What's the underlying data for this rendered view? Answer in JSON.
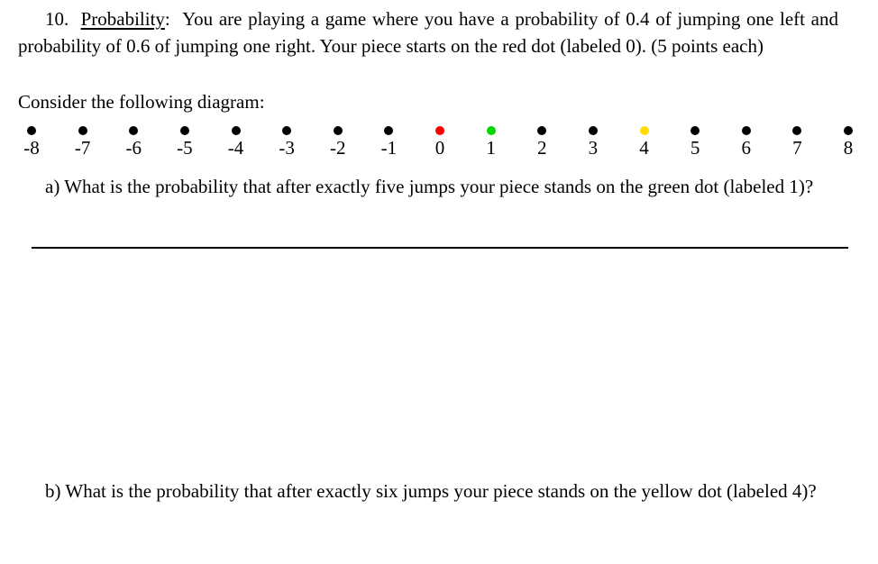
{
  "document": {
    "problem_number": "10.",
    "topic_label": "Probability",
    "topic_colon": ":",
    "statement_line1": "You are playing a game where you have a probability of 0.4 of",
    "statement_line2": "jumping one left and probability of 0.6 of jumping one right. Your piece starts on the red",
    "statement_line3": "dot (labeled 0). (5 points each)",
    "consider_line": "Consider the following diagram:"
  },
  "diagram": {
    "type": "number-line",
    "min": -8,
    "max": 8,
    "axis_color": "#000000",
    "default_dot_color": "#000000",
    "nodes": [
      {
        "value": -8,
        "label": "-8",
        "color": "#000000",
        "name": "minus-8"
      },
      {
        "value": -7,
        "label": "-7",
        "color": "#000000",
        "name": "minus-7"
      },
      {
        "value": -6,
        "label": "-6",
        "color": "#000000",
        "name": "minus-6"
      },
      {
        "value": -5,
        "label": "-5",
        "color": "#000000",
        "name": "minus-5"
      },
      {
        "value": -4,
        "label": "-4",
        "color": "#000000",
        "name": "minus-4"
      },
      {
        "value": -3,
        "label": "-3",
        "color": "#000000",
        "name": "minus-3"
      },
      {
        "value": -2,
        "label": "-2",
        "color": "#000000",
        "name": "minus-2"
      },
      {
        "value": -1,
        "label": "-1",
        "color": "#000000",
        "name": "minus-1"
      },
      {
        "value": 0,
        "label": "0",
        "color": "#fa0000",
        "name": "zero-red"
      },
      {
        "value": 1,
        "label": "1",
        "color": "#00d800",
        "name": "one-green"
      },
      {
        "value": 2,
        "label": "2",
        "color": "#000000",
        "name": "two"
      },
      {
        "value": 3,
        "label": "3",
        "color": "#000000",
        "name": "three"
      },
      {
        "value": 4,
        "label": "4",
        "color": "#ffdd00",
        "name": "four-yellow"
      },
      {
        "value": 5,
        "label": "5",
        "color": "#000000",
        "name": "five"
      },
      {
        "value": 6,
        "label": "6",
        "color": "#000000",
        "name": "six"
      },
      {
        "value": 7,
        "label": "7",
        "color": "#000000",
        "name": "seven"
      },
      {
        "value": 8,
        "label": "8",
        "color": "#000000",
        "name": "eight"
      }
    ]
  },
  "parts": {
    "a": {
      "marker": "a)",
      "line1": "What is the probability that after exactly five jumps your piece stands on the green",
      "line2": "dot (labeled 1)?"
    },
    "b": {
      "marker": "b)",
      "line1": "What is the probability that after exactly six jumps your piece stands on the yellow",
      "line2": "dot (labeled 4)?"
    }
  }
}
